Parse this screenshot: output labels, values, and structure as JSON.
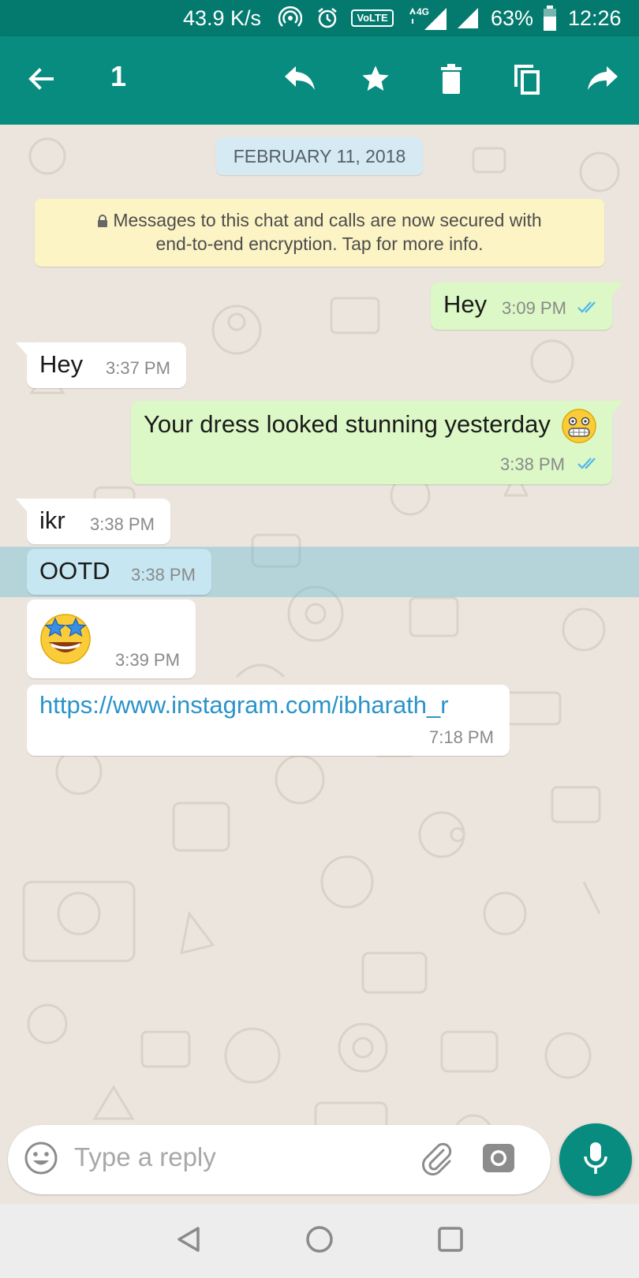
{
  "status_bar": {
    "speed": "43.9 K/s",
    "volte": "VoLTE",
    "network": "4G",
    "battery": "63%",
    "time": "12:26"
  },
  "action_bar": {
    "selected_count": "1",
    "icons": [
      "back-arrow-icon",
      "reply-icon",
      "star-icon",
      "delete-icon",
      "copy-icon",
      "forward-icon"
    ]
  },
  "chat": {
    "date_chip": "FEBRUARY 11, 2018",
    "encryption_notice_line1": "Messages to this chat and calls are now secured with",
    "encryption_notice_line2": "end-to-end encryption. Tap for more info.",
    "messages": [
      {
        "direction": "outgoing",
        "text": "Hey",
        "time": "3:09 PM",
        "status": "read"
      },
      {
        "direction": "incoming",
        "text": "Hey",
        "time": "3:37 PM"
      },
      {
        "direction": "outgoing",
        "text": "Your dress looked stunning yesterday",
        "emoji": "grimacing-face",
        "time": "3:38 PM",
        "status": "read"
      },
      {
        "direction": "incoming",
        "text": "ikr",
        "time": "3:38 PM"
      },
      {
        "direction": "incoming",
        "text": "OOTD",
        "time": "3:38 PM",
        "selected": true
      },
      {
        "direction": "incoming",
        "emoji": "star-struck",
        "time": "3:39 PM"
      },
      {
        "direction": "incoming",
        "text": "https://www.instagram.com/ibharath_r",
        "time": "7:18 PM",
        "is_link": true
      }
    ]
  },
  "composer": {
    "placeholder": "Type a reply"
  },
  "colors": {
    "header": "#078c7f",
    "status_bar": "#047a6f",
    "outgoing_bubble": "#dcf8c6",
    "incoming_bubble": "#ffffff",
    "chat_bg": "#ece5dd",
    "read_ticks": "#4fb6ec",
    "link": "#2a93c9",
    "selection": "#70bed7"
  }
}
